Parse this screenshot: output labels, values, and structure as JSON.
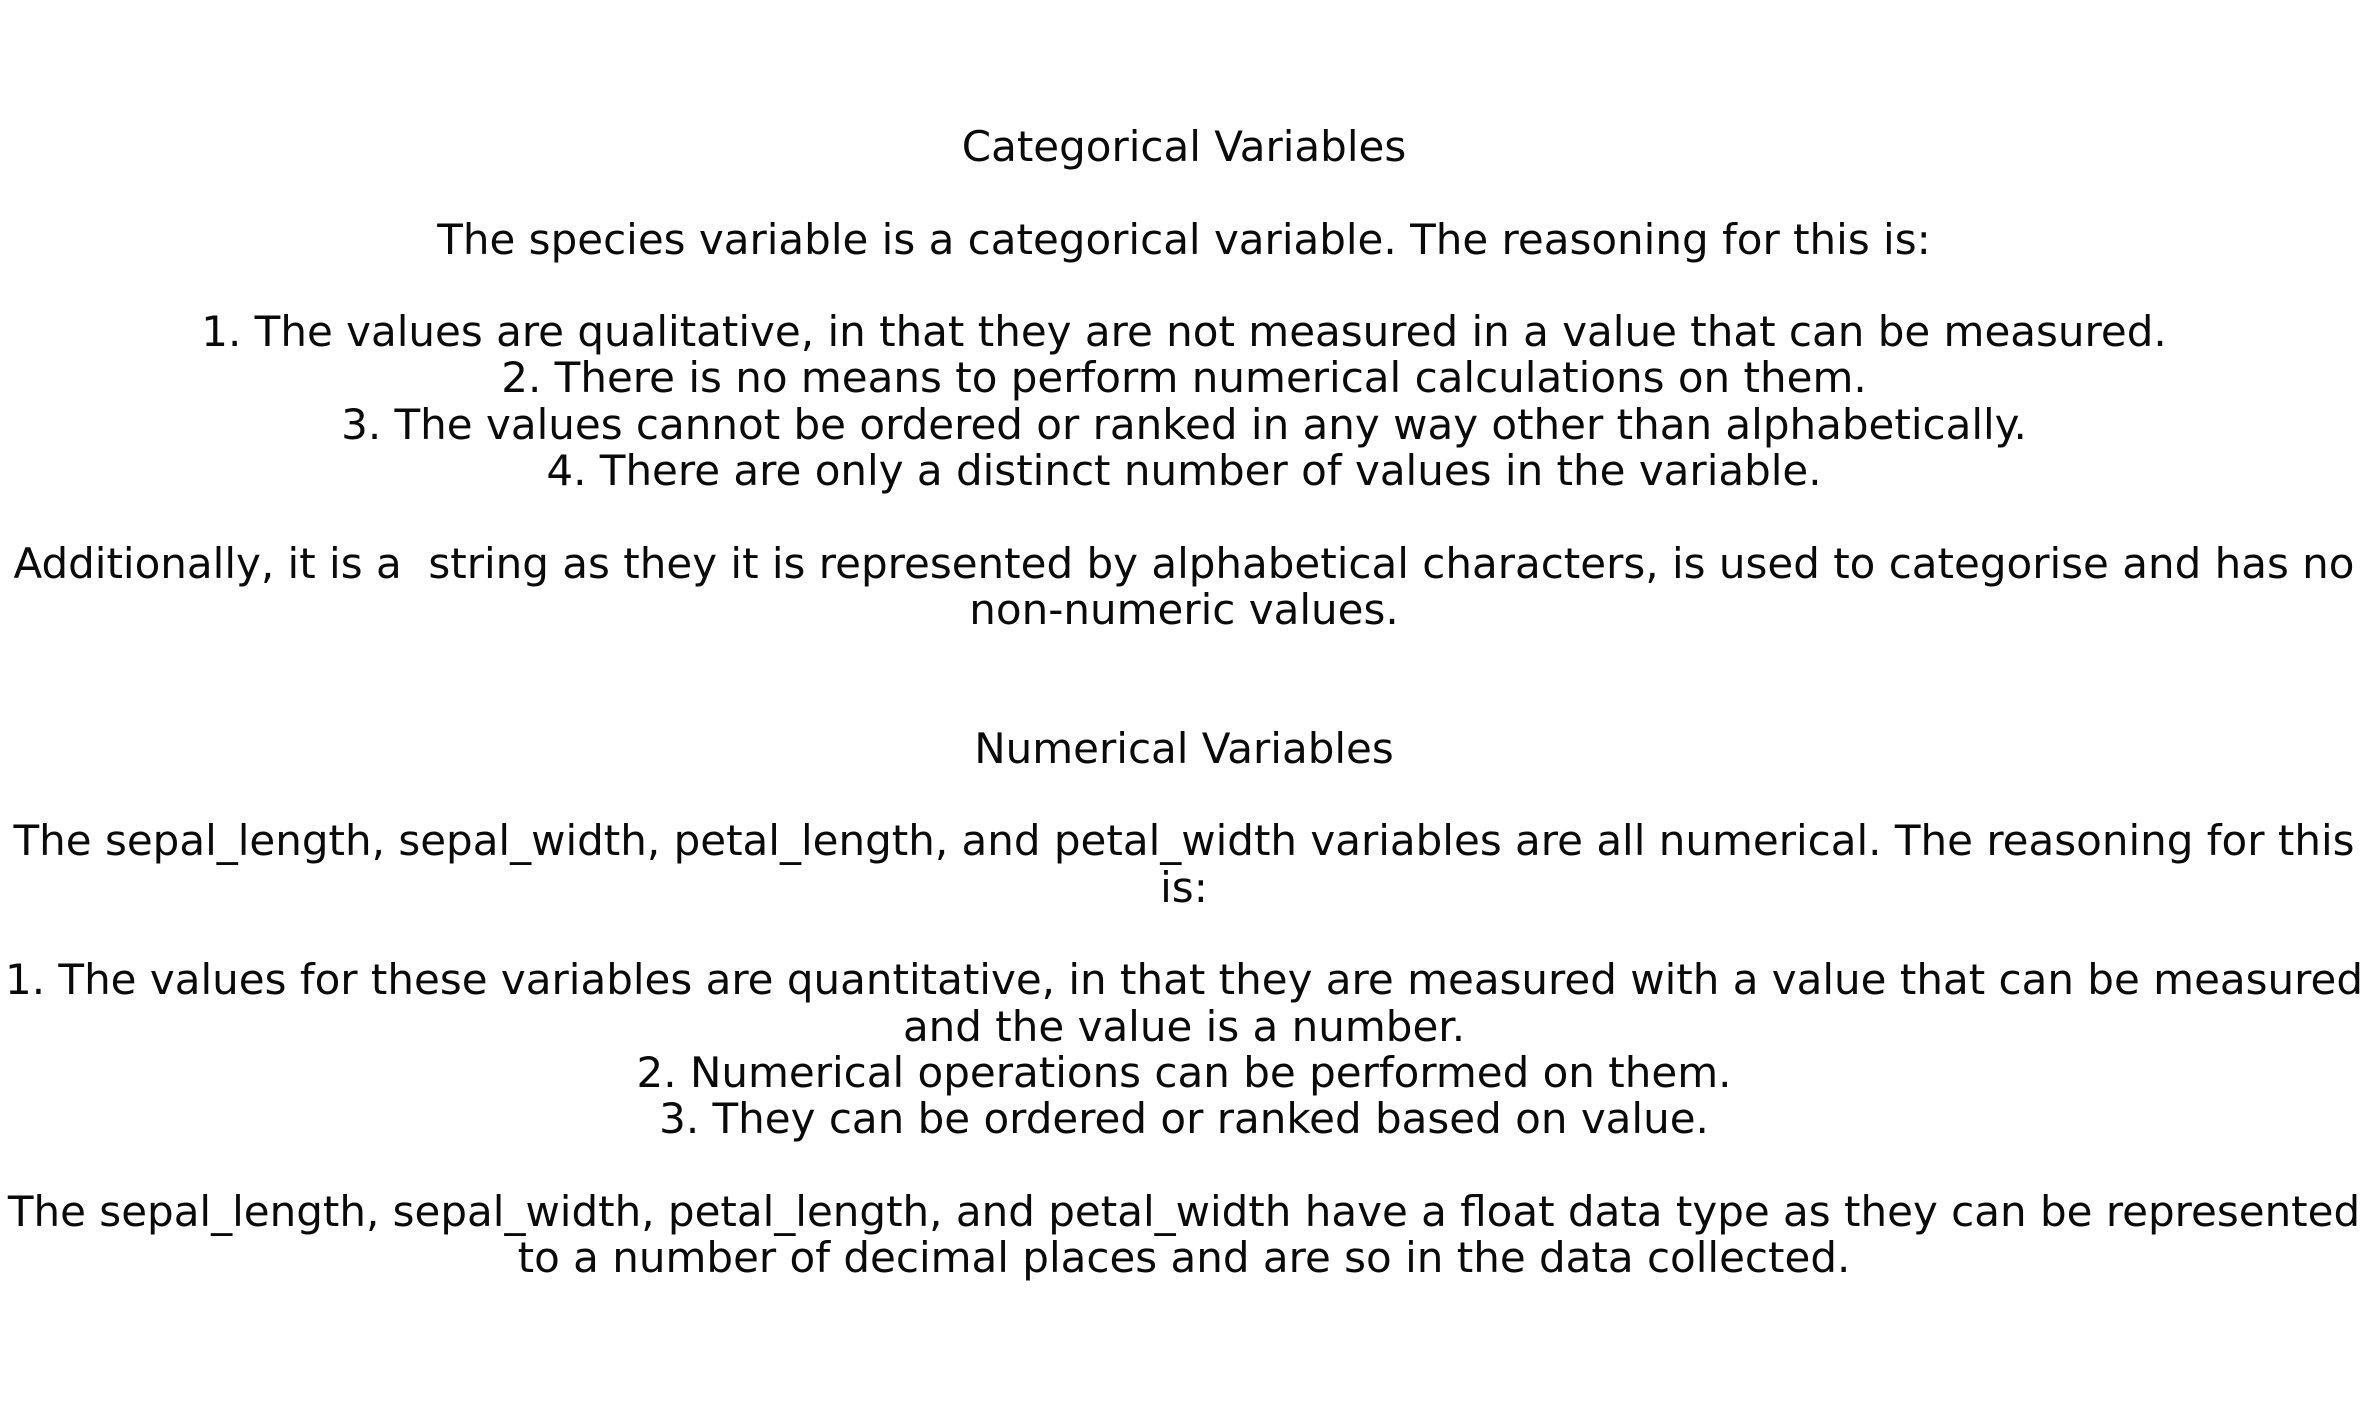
{
  "categorical": {
    "heading": "Categorical Variables",
    "intro": "The species variable is a categorical variable. The reasoning for this is:",
    "points": [
      "1. The values are qualitative, in that they are not measured in a value that can be measured.",
      "2. There is no means to perform numerical calculations on them.",
      "3. The values cannot be ordered or ranked in any way other than alphabetically.",
      "4. There are only a distinct number of values in the variable."
    ],
    "additional_line1": "Additionally, it is a  string as they it is represented by alphabetical characters, is used to categorise and has no",
    "additional_line2": "non-numeric values."
  },
  "numerical": {
    "heading": "Numerical Variables",
    "intro_line1": "The sepal_length, sepal_width, petal_length, and petal_width variables are all numerical. The reasoning for this",
    "intro_line2": "is:",
    "point1_line1": "1. The values for these variables are quantitative, in that they are measured with a value that can be measured",
    "point1_line2": "and the value is a number.",
    "point2": "2. Numerical operations can be performed on them.",
    "point3": "3. They can be ordered or ranked based on value.",
    "conclusion_line1": "The sepal_length, sepal_width, petal_length, and petal_width have a float data type as they can be represented",
    "conclusion_line2": "to a number of decimal places and are so in the data collected."
  }
}
